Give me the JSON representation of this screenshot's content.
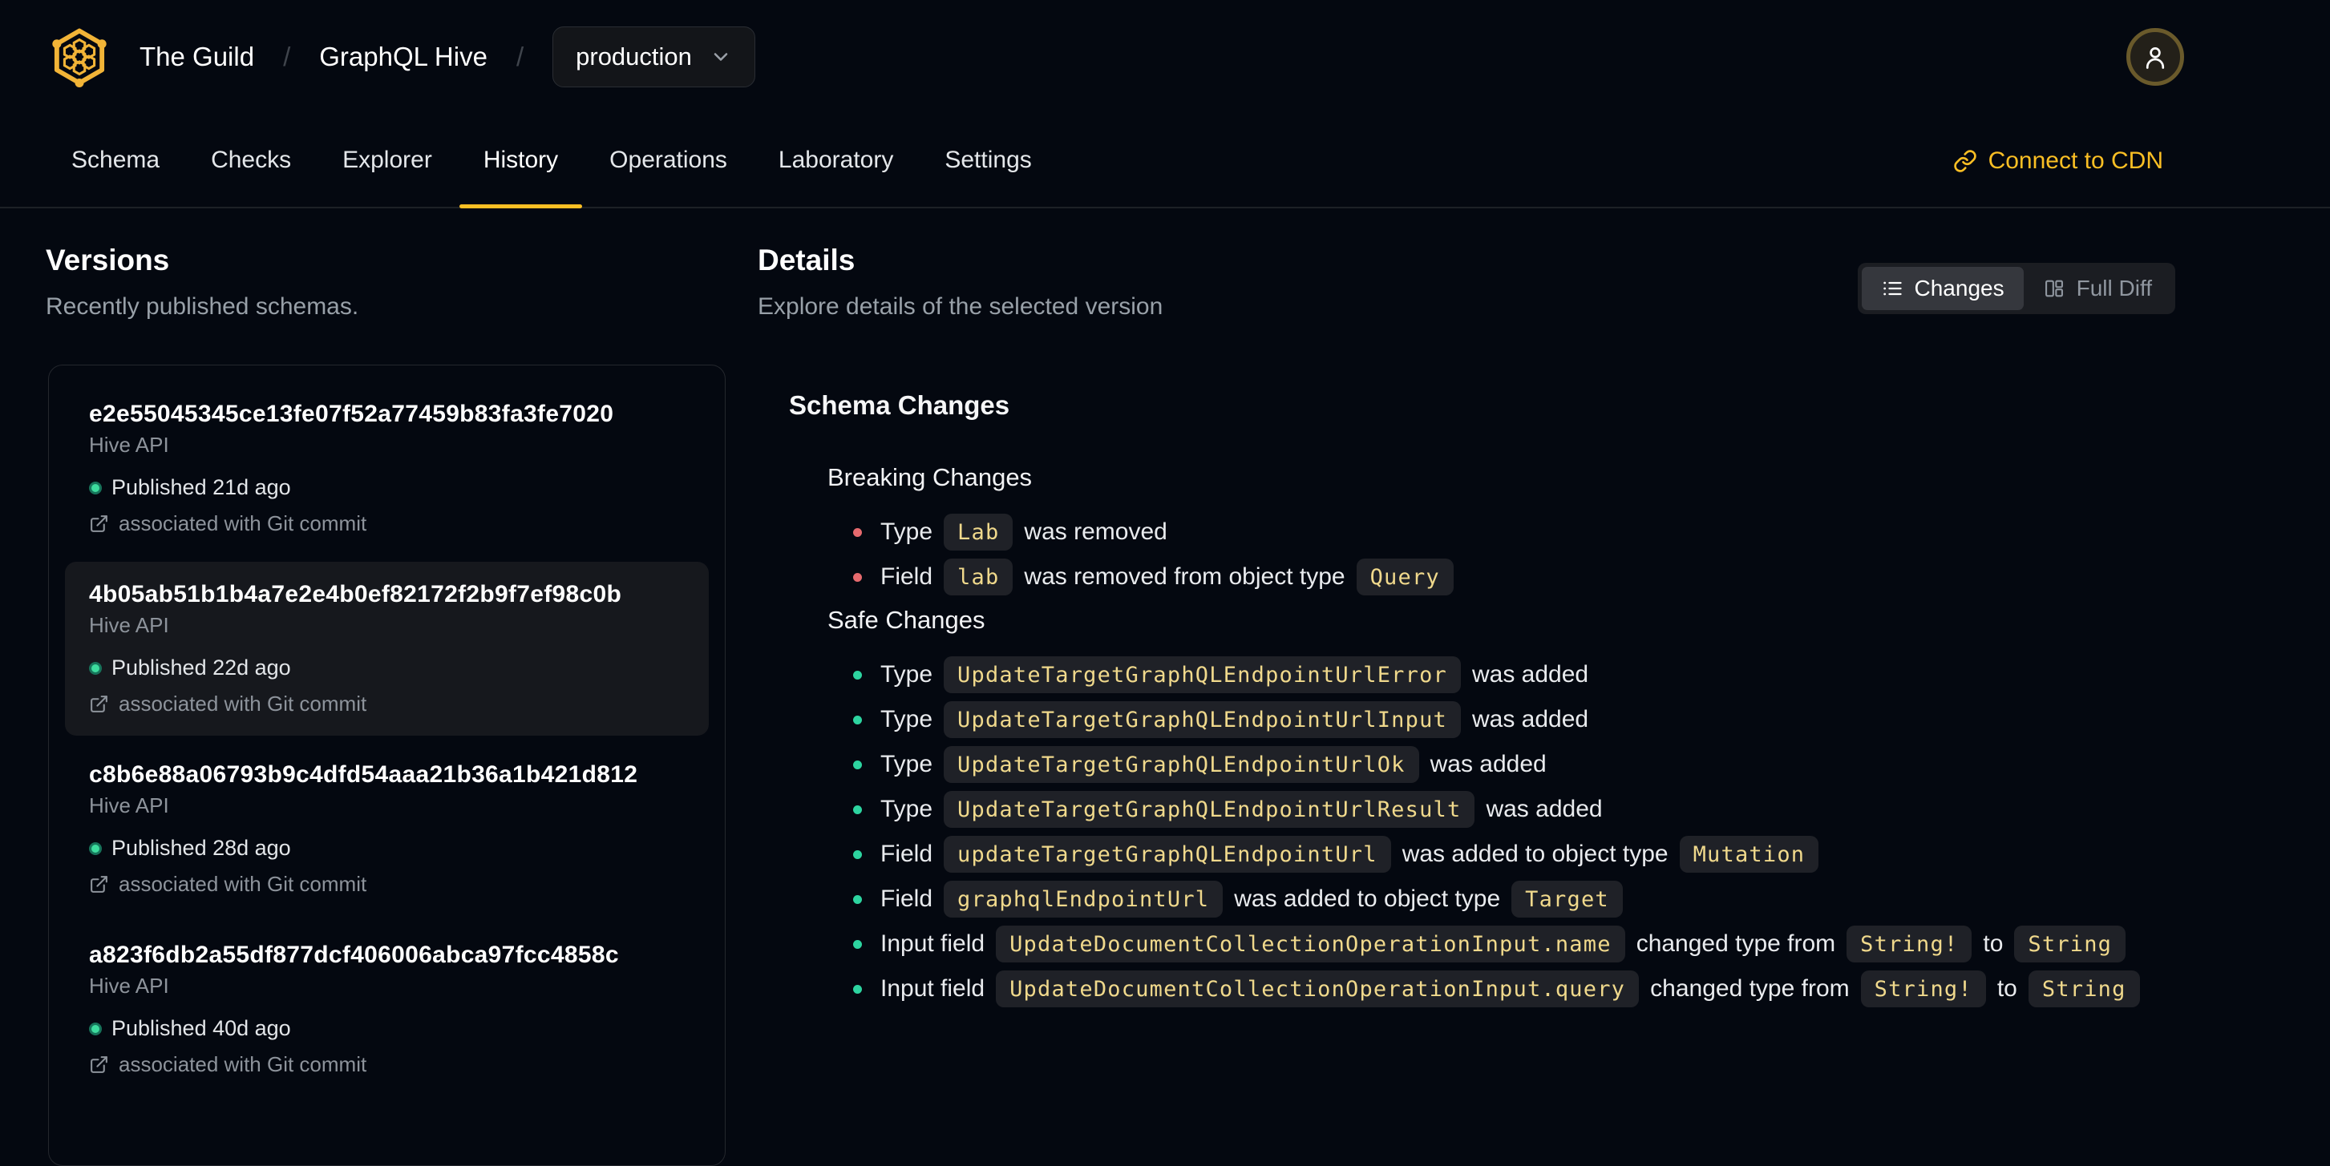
{
  "header": {
    "org": "The Guild",
    "separator": "/",
    "project": "GraphQL Hive",
    "target": "production",
    "connect_cdn_label": "Connect to CDN"
  },
  "tabs": {
    "active": "History",
    "items": [
      {
        "label": "Schema"
      },
      {
        "label": "Checks"
      },
      {
        "label": "Explorer"
      },
      {
        "label": "History"
      },
      {
        "label": "Operations"
      },
      {
        "label": "Laboratory"
      },
      {
        "label": "Settings"
      }
    ]
  },
  "versions": {
    "title": "Versions",
    "subtitle": "Recently published schemas.",
    "items": [
      {
        "hash": "e2e55045345ce13fe07f52a77459b83fa3fe7020",
        "service": "Hive API",
        "published": "Published 21d ago",
        "git_link": "associated with Git commit",
        "selected": false
      },
      {
        "hash": "4b05ab51b1b4a7e2e4b0ef82172f2b9f7ef98c0b",
        "service": "Hive API",
        "published": "Published 22d ago",
        "git_link": "associated with Git commit",
        "selected": true
      },
      {
        "hash": "c8b6e88a06793b9c4dfd54aaa21b36a1b421d812",
        "service": "Hive API",
        "published": "Published 28d ago",
        "git_link": "associated with Git commit",
        "selected": false
      },
      {
        "hash": "a823f6db2a55df877dcf406006abca97fcc4858c",
        "service": "Hive API",
        "published": "Published 40d ago",
        "git_link": "associated with Git commit",
        "selected": false
      }
    ]
  },
  "details": {
    "title": "Details",
    "subtitle": "Explore details of the selected version",
    "view_toggle": {
      "changes_label": "Changes",
      "full_diff_label": "Full Diff",
      "active": "Changes"
    },
    "schema_changes_title": "Schema Changes",
    "breaking_title": "Breaking Changes",
    "safe_title": "Safe Changes",
    "breaking_changes": [
      {
        "prefix": "Type",
        "code": "Lab",
        "suffix": "was removed"
      },
      {
        "prefix": "Field",
        "code": "lab",
        "suffix": "was removed from object type",
        "code2": "Query"
      }
    ],
    "safe_changes": [
      {
        "prefix": "Type",
        "code": "UpdateTargetGraphQLEndpointUrlError",
        "suffix": "was added"
      },
      {
        "prefix": "Type",
        "code": "UpdateTargetGraphQLEndpointUrlInput",
        "suffix": "was added"
      },
      {
        "prefix": "Type",
        "code": "UpdateTargetGraphQLEndpointUrlOk",
        "suffix": "was added"
      },
      {
        "prefix": "Type",
        "code": "UpdateTargetGraphQLEndpointUrlResult",
        "suffix": "was added"
      },
      {
        "prefix": "Field",
        "code": "updateTargetGraphQLEndpointUrl",
        "suffix": "was added to object type",
        "code2": "Mutation"
      },
      {
        "prefix": "Field",
        "code": "graphqlEndpointUrl",
        "suffix": "was added to object type",
        "code2": "Target"
      },
      {
        "prefix": "Input field",
        "code": "UpdateDocumentCollectionOperationInput.name",
        "suffix": "changed type from",
        "code2": "String!",
        "connector": "to",
        "code3": "String"
      },
      {
        "prefix": "Input field",
        "code": "UpdateDocumentCollectionOperationInput.query",
        "suffix": "changed type from",
        "code2": "String!",
        "connector": "to",
        "code3": "String"
      }
    ]
  },
  "colors": {
    "accent": "#fbbf24",
    "code_text": "#f0d98c",
    "breaking_bullet": "#e66a6e",
    "safe_bullet": "#2dd4a0",
    "published_dot": "#3ddc9e"
  },
  "icons": {
    "logo": "hive-logo",
    "target_dropdown": "chevron-down-icon",
    "avatar": "user-icon",
    "connect_cdn": "link-icon",
    "changes_view": "list-icon",
    "full_diff_view": "columns-icon",
    "git_association": "external-link-icon"
  }
}
